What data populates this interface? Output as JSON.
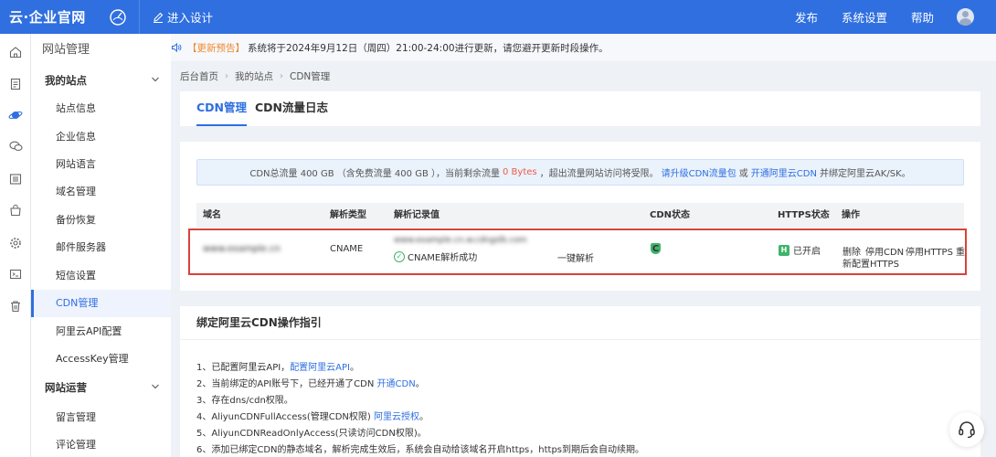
{
  "header": {
    "logo": "云·企业官网",
    "design_label": "进入设计",
    "nav": [
      "发布",
      "系统设置",
      "帮助"
    ],
    "brand_color": "#2f6fe0"
  },
  "rail_icons": [
    "home-icon",
    "page-icon",
    "planet-icon",
    "chat-icon",
    "list-icon",
    "bag-icon",
    "settings-icon",
    "terminal-icon",
    "trash-icon"
  ],
  "sidebar": {
    "title": "网站管理",
    "groups": [
      {
        "label": "我的站点",
        "items": [
          "站点信息",
          "企业信息",
          "网站语言",
          "域名管理",
          "备份恢复",
          "邮件服务器",
          "短信设置",
          "CDN管理",
          "阿里云API配置",
          "AccessKey管理"
        ]
      },
      {
        "label": "网站运营",
        "items": [
          "留言管理",
          "评论管理"
        ]
      }
    ],
    "active_item": "CDN管理"
  },
  "notice": {
    "prefix": "【更新预告】",
    "text": "系统将于2024年9月12日（周四）21:00-24:00进行更新，请您避开更新时段操作。"
  },
  "breadcrumb": [
    "后台首页",
    "我的站点",
    "CDN管理"
  ],
  "tabs": [
    "CDN管理",
    "CDN流量日志"
  ],
  "info": {
    "part1": "CDN总流量 400 GB （含免费流量 400 GB ），当前剩余流量",
    "remaining": "0 Bytes",
    "part2": "，超出流量网站访问将受限。",
    "link1": "请升级CDN流量包",
    "or": "或",
    "link2": "开通阿里云CDN",
    "part3": "并绑定阿里云AK/SK。"
  },
  "table": {
    "headers": [
      "域名",
      "解析类型",
      "解析记录值",
      "CDN状态",
      "HTTPS状态",
      "操作"
    ],
    "row": {
      "domain": "www.example.cn",
      "type": "CNAME",
      "record": "www.example.cn.w.cdngslb.com",
      "record_status": "CNAME解析成功",
      "resolve_link": "一键解析",
      "cdn_badge": "C",
      "https_badge": "H",
      "https_text": "已开启",
      "actions": [
        "删除",
        "停用CDN",
        "停用HTTPS"
      ],
      "action_reconfig_1": "重",
      "action_reconfig_2": "新配置HTTPS"
    }
  },
  "guide": {
    "title": "绑定阿里云CDN操作指引",
    "steps": [
      {
        "text": "1、已配置阿里云API，",
        "link": "配置阿里云API",
        "after": "。"
      },
      {
        "text": "2、当前绑定的API账号下，已经开通了CDN",
        "link": "开通CDN",
        "after": "。"
      },
      {
        "text": "3、存在dns/cdn权限。",
        "link": "",
        "after": ""
      },
      {
        "text": "4、AliyunCDNFullAccess(管理CDN权限)",
        "link": "阿里云授权",
        "after": "。"
      },
      {
        "text": "5、AliyunCDNReadOnlyAccess(只读访问CDN权限)。",
        "link": "",
        "after": ""
      },
      {
        "text": "6、添加已绑定CDN的静态域名，解析完成生效后，系统会自动给该域名开启https，https到期后会自动续期。",
        "link": "",
        "after": ""
      }
    ]
  }
}
